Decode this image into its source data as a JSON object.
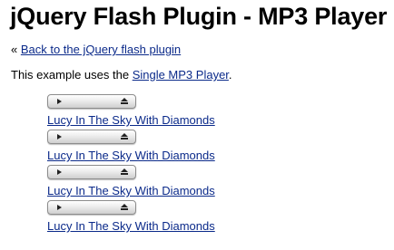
{
  "page": {
    "title": "jQuery Flash Plugin - MP3 Player"
  },
  "back": {
    "prefix": "« ",
    "link_text": "Back to the jQuery flash plugin"
  },
  "intro": {
    "text_before": "This example uses the ",
    "link_text": "Single MP3 Player",
    "text_after": "."
  },
  "players": [
    {
      "track": "Lucy In The Sky With Diamonds",
      "play_icon": "play-icon",
      "eject_icon": "eject-icon"
    },
    {
      "track": "Lucy In The Sky With Diamonds",
      "play_icon": "play-icon",
      "eject_icon": "eject-icon"
    },
    {
      "track": "Lucy In The Sky With Diamonds",
      "play_icon": "play-icon",
      "eject_icon": "eject-icon"
    },
    {
      "track": "Lucy In The Sky With Diamonds",
      "play_icon": "play-icon",
      "eject_icon": "eject-icon"
    }
  ],
  "colors": {
    "link": "#0b2a8a",
    "text": "#000000",
    "background": "#ffffff"
  }
}
